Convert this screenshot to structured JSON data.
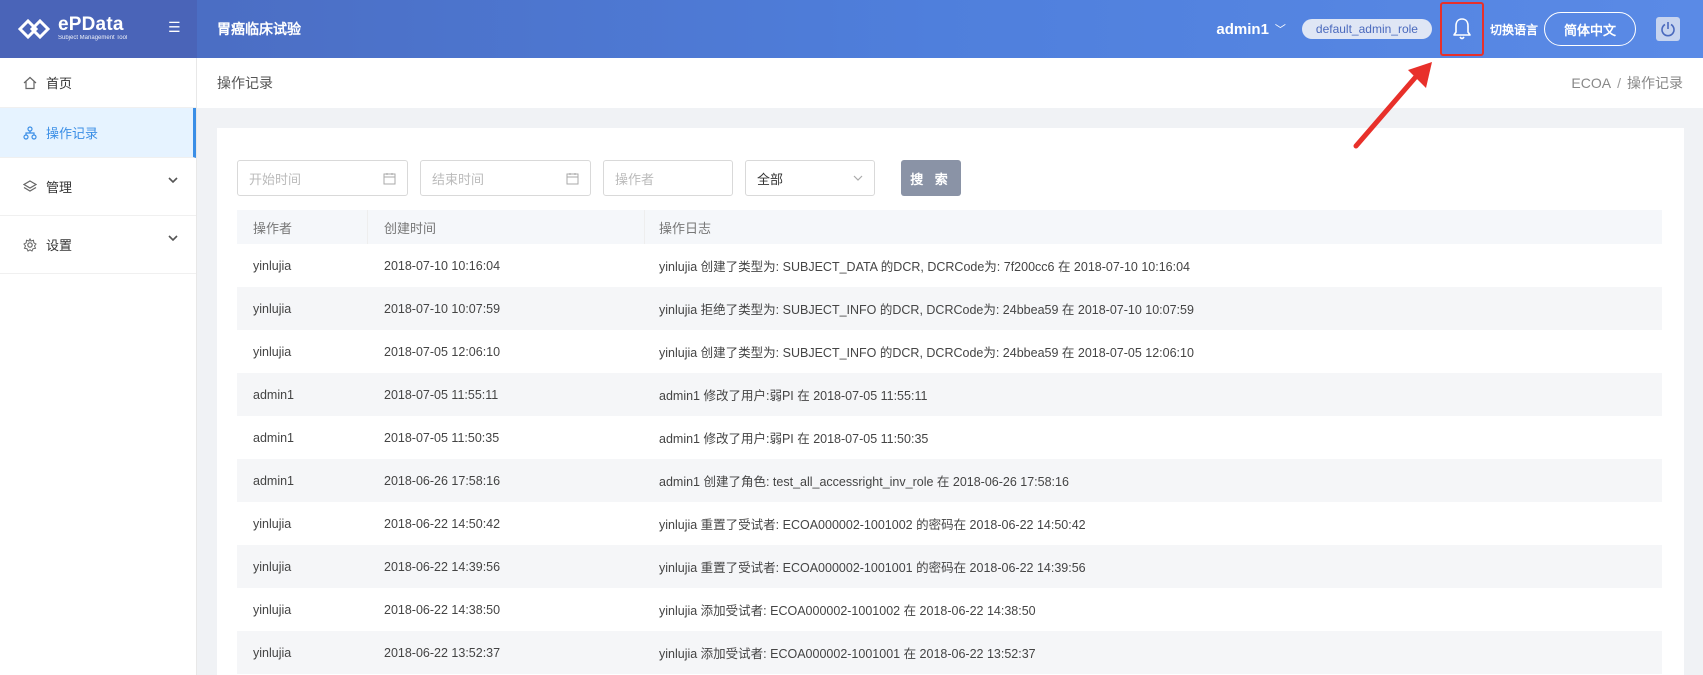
{
  "app": {
    "logo_title": "ePData",
    "logo_subtitle": "Subject Management Tool",
    "project_title": "胃癌临床试验"
  },
  "header": {
    "user_name": "admin1",
    "role": "default_admin_role",
    "switch_language_label": "切换语言",
    "language_button": "简体中文",
    "accent_color": "#4f7fdc",
    "annotation_color": "#e8302a"
  },
  "sidebar": {
    "items": [
      {
        "label": "首页",
        "icon": "home-icon"
      },
      {
        "label": "操作记录",
        "icon": "hierarchy-icon"
      },
      {
        "label": "管理",
        "icon": "layers-icon"
      },
      {
        "label": "设置",
        "icon": "gear-icon"
      }
    ]
  },
  "page": {
    "title": "操作记录",
    "breadcrumb": [
      "ECOA",
      "操作记录"
    ],
    "breadcrumb_sep": "/"
  },
  "filters": {
    "start_placeholder": "开始时间",
    "end_placeholder": "结束时间",
    "operator_placeholder": "操作者",
    "type_select": "全部",
    "search_label": "搜 索"
  },
  "table": {
    "headers": [
      "操作者",
      "创建时间",
      "操作日志"
    ],
    "rows": [
      {
        "operator": "yinlujia",
        "time": "2018-07-10 10:16:04",
        "log": "yinlujia 创建了类型为: SUBJECT_DATA 的DCR, DCRCode为: 7f200cc6 在 2018-07-10 10:16:04"
      },
      {
        "operator": "yinlujia",
        "time": "2018-07-10 10:07:59",
        "log": "yinlujia 拒绝了类型为: SUBJECT_INFO 的DCR, DCRCode为: 24bbea59 在 2018-07-10 10:07:59"
      },
      {
        "operator": "yinlujia",
        "time": "2018-07-05 12:06:10",
        "log": "yinlujia 创建了类型为: SUBJECT_INFO 的DCR, DCRCode为: 24bbea59 在 2018-07-05 12:06:10"
      },
      {
        "operator": "admin1",
        "time": "2018-07-05 11:55:11",
        "log": "admin1 修改了用户:弱PI 在 2018-07-05 11:55:11"
      },
      {
        "operator": "admin1",
        "time": "2018-07-05 11:50:35",
        "log": "admin1 修改了用户:弱PI 在 2018-07-05 11:50:35"
      },
      {
        "operator": "admin1",
        "time": "2018-06-26 17:58:16",
        "log": "admin1 创建了角色: test_all_accessright_inv_role 在 2018-06-26 17:58:16"
      },
      {
        "operator": "yinlujia",
        "time": "2018-06-22 14:50:42",
        "log": "yinlujia 重置了受试者: ECOA000002-1001002 的密码在 2018-06-22 14:50:42"
      },
      {
        "operator": "yinlujia",
        "time": "2018-06-22 14:39:56",
        "log": "yinlujia 重置了受试者: ECOA000002-1001001 的密码在 2018-06-22 14:39:56"
      },
      {
        "operator": "yinlujia",
        "time": "2018-06-22 14:38:50",
        "log": "yinlujia 添加受试者: ECOA000002-1001002 在 2018-06-22 14:38:50"
      },
      {
        "operator": "yinlujia",
        "time": "2018-06-22 13:52:37",
        "log": "yinlujia 添加受试者: ECOA000002-1001001 在 2018-06-22 13:52:37"
      }
    ]
  }
}
